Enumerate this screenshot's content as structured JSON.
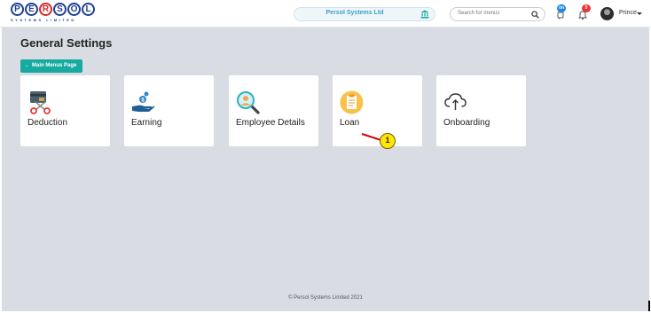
{
  "logo": {
    "letters": [
      "P",
      "E",
      "R",
      "S",
      "O",
      "L"
    ],
    "tagline": "SYSTEMS LIMITED"
  },
  "header": {
    "company": "Persol Systems Ltd",
    "search_placeholder": "Search for menus",
    "chat_badge": "on",
    "notification_badge": "5",
    "username": "Prince"
  },
  "page": {
    "title": "General Settings",
    "back_button": "Main Menus Page"
  },
  "cards": [
    {
      "label": "Deduction",
      "icon": "scissors-card-icon"
    },
    {
      "label": "Earning",
      "icon": "hand-coins-icon"
    },
    {
      "label": "Employee Details",
      "icon": "magnifier-person-icon"
    },
    {
      "label": "Loan",
      "icon": "clipboard-icon"
    },
    {
      "label": "Onboarding",
      "icon": "cloud-upload-icon"
    }
  ],
  "callout": {
    "number": "1"
  },
  "footer": {
    "text": "© Persol Systems Limited 2021"
  },
  "colors": {
    "accent": "#17aaa0",
    "brand_blue": "#1f3f95",
    "brand_red": "#d62a2a",
    "background": "#d9dde3"
  }
}
